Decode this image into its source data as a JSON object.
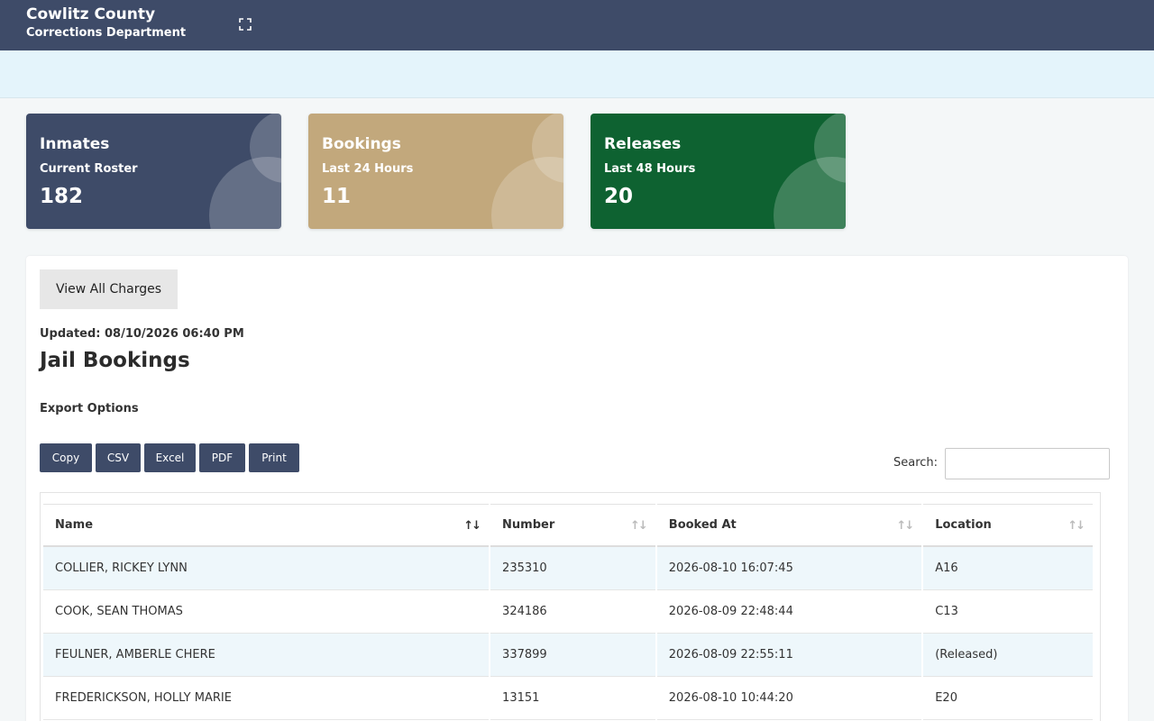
{
  "header": {
    "county": "Cowlitz County",
    "department": "Corrections Department",
    "fullscreen_icon": "fullscreen-icon"
  },
  "cards": [
    {
      "title": "Inmates",
      "subtitle": "Current Roster",
      "value": "182",
      "color": "#3e4b68"
    },
    {
      "title": "Bookings",
      "subtitle": "Last 24 Hours",
      "value": "11",
      "color": "#c2a87c"
    },
    {
      "title": "Releases",
      "subtitle": "Last 48 Hours",
      "value": "20",
      "color": "#0e6231"
    }
  ],
  "main": {
    "view_all_charges": "View All Charges",
    "updated": "Updated: 08/10/2026 06:40 PM",
    "heading": "Jail Bookings",
    "export_label": "Export Options",
    "export_buttons": [
      "Copy",
      "CSV",
      "Excel",
      "PDF",
      "Print"
    ],
    "search_label": "Search:",
    "search_value": ""
  },
  "table": {
    "columns": [
      "Name",
      "Number",
      "Booked At",
      "Location"
    ],
    "rows": [
      [
        "COLLIER, RICKEY LYNN",
        "235310",
        "2026-08-10 16:07:45",
        "A16"
      ],
      [
        "COOK, SEAN THOMAS",
        "324186",
        "2026-08-09 22:48:44",
        "C13"
      ],
      [
        "FEULNER, AMBERLE CHERE",
        "337899",
        "2026-08-09 22:55:11",
        "(Released)"
      ],
      [
        "FREDERICKSON, HOLLY MARIE",
        "13151",
        "2026-08-10 10:44:20",
        "E20"
      ]
    ]
  },
  "colors": {
    "topbar": "#3e4b68",
    "subbar": "#e4f4fb",
    "button": "#3e4b68",
    "row_stripe": "#eef7fb"
  }
}
